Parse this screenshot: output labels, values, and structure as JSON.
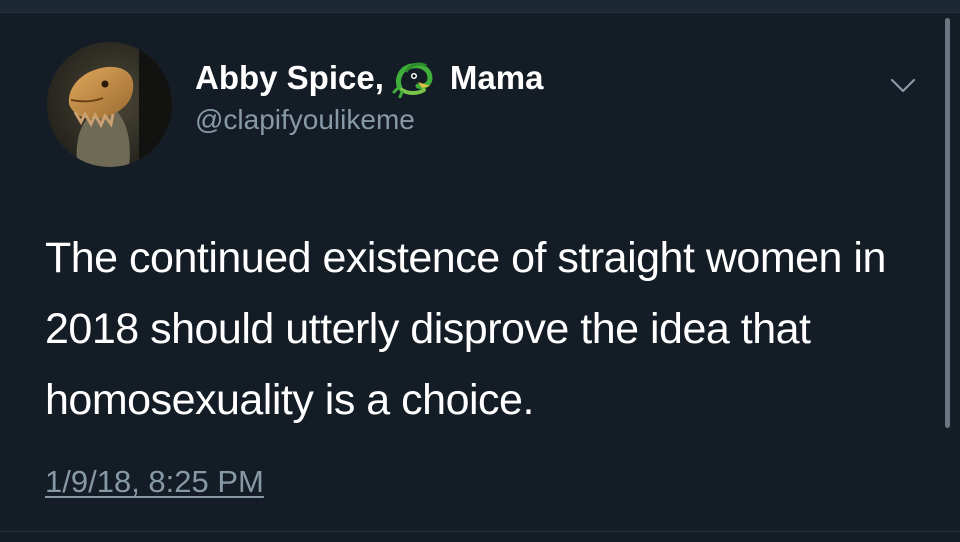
{
  "tweet": {
    "display_name_part1": "Abby Spice,",
    "display_name_emoji": "dragon-emoji-icon",
    "display_name_part2": "Mama",
    "handle": "@clapifyoulikeme",
    "text": "The continued existence of straight women in 2018 should utterly disprove the idea that homosexuality is a choice.",
    "timestamp": "1/9/18, 8:25 PM",
    "menu_icon": "chevron-down-icon"
  },
  "colors": {
    "background": "#141d26",
    "text_primary": "#ffffff",
    "text_secondary": "#8899a6"
  }
}
